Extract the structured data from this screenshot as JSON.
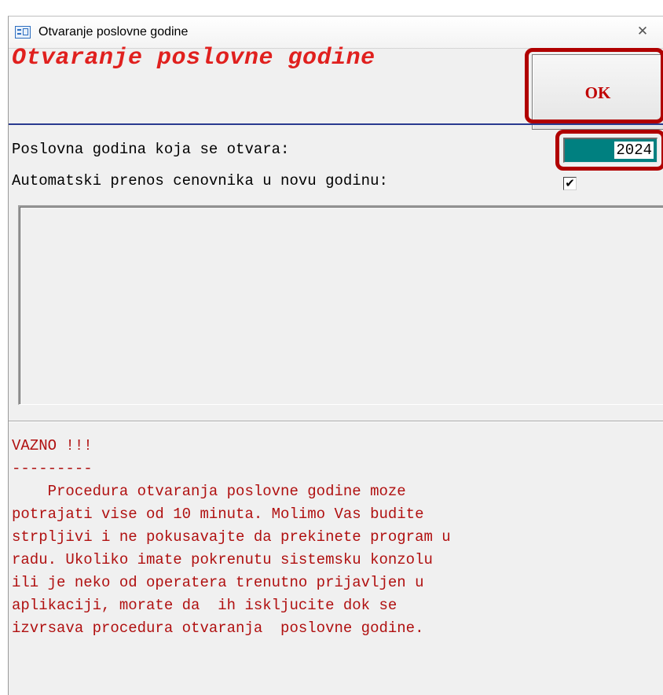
{
  "window": {
    "title": "Otvaranje poslovne godine",
    "close_glyph": "✕"
  },
  "form": {
    "header": "Otvaranje poslovne godine",
    "ok_label": "OK",
    "year_label": "Poslovna godina koja se otvara:",
    "year_value": "2024",
    "transfer_label": "Automatski prenos cenovnika u novu godinu:",
    "transfer_checked": true,
    "checkmark": "✔"
  },
  "note": {
    "lines": [
      "VAZNO !!!",
      "---------",
      "    Procedura otvaranja poslovne godine moze",
      "potrajati vise od 10 minuta. Molimo Vas budite",
      "strpljivi i ne pokusavajte da prekinete program u",
      "radu. Ukoliko imate pokrenutu sistemsku konzolu",
      "ili je neko od operatera trenutno prijavljen u",
      "aplikaciji, morate da  ih iskljucite dok se",
      "izvrsava procedura otvaranja  poslovne godine."
    ]
  },
  "colors": {
    "header_red": "#e0201e",
    "note_red": "#b01010",
    "input_teal": "#008080",
    "highlight_red": "#b00000",
    "separator_blue": "#2a3b8f"
  },
  "icons": {
    "app": "form-icon",
    "close": "close-icon",
    "checkbox": "checkmark-icon"
  }
}
